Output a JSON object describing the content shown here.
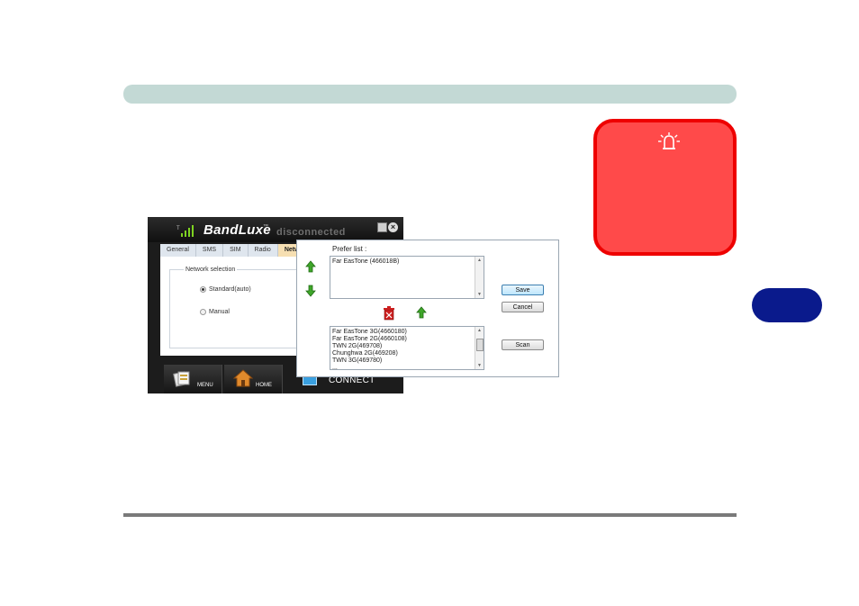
{
  "colors": {
    "header_bar": "#c3d9d5",
    "chapter_tab": "#0a1a8c",
    "warning_fill": "#ff4a4a",
    "warning_border": "#ee0000",
    "footer_line": "#7a7a7a"
  },
  "warning": {
    "icon": "alarm-bell-icon"
  },
  "app": {
    "brand": "BandLuxe",
    "trademark": "™",
    "status": "disconnected",
    "close_glyph": "×",
    "tabs": [
      {
        "label": "General"
      },
      {
        "label": "SMS"
      },
      {
        "label": "SIM"
      },
      {
        "label": "Radio"
      },
      {
        "label": "Network"
      }
    ],
    "network_selection": {
      "label": "Network selection",
      "options": [
        {
          "label": "Standard(auto)",
          "checked": true
        },
        {
          "label": "Manual",
          "checked": false
        }
      ]
    },
    "nav": {
      "menu": "MENU",
      "home": "HOME",
      "connect": "CONNECT"
    }
  },
  "dialog": {
    "prefer_label": "Prefer list :",
    "prefer_items": [
      "Far EasTone (466018B)"
    ],
    "available_items": [
      "Far EasTone 3G(4660180)",
      "Far EasTone 2G(4660108)",
      "TWN 2G(469708)",
      "Chunghwa 2G(469208)",
      "TWN 3G(469780)",
      "..."
    ],
    "buttons": {
      "save": "Save",
      "cancel": "Cancel",
      "scan": "Scan"
    }
  }
}
